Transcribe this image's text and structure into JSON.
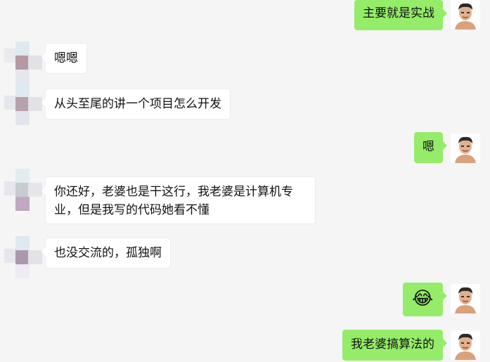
{
  "messages": [
    {
      "side": "right",
      "text": "主要就是实战"
    },
    {
      "side": "left",
      "text": "嗯嗯"
    },
    {
      "side": "left",
      "text": "从头至尾的讲一个项目怎么开发"
    },
    {
      "side": "right",
      "text": "嗯"
    },
    {
      "side": "left",
      "text": "你还好，老婆也是干这行，我老婆是计算机专业，但是我写的代码她看不懂"
    },
    {
      "side": "left",
      "text": "也没交流的，孤独啊"
    },
    {
      "side": "right",
      "emoji": "😂",
      "emoji_name": "tears-of-joy-emoji"
    },
    {
      "side": "right",
      "text": "我老婆搞算法的"
    }
  ],
  "colors": {
    "background": "#f5f5f5",
    "right_bubble": "#95ec69",
    "left_bubble": "#ffffff"
  }
}
